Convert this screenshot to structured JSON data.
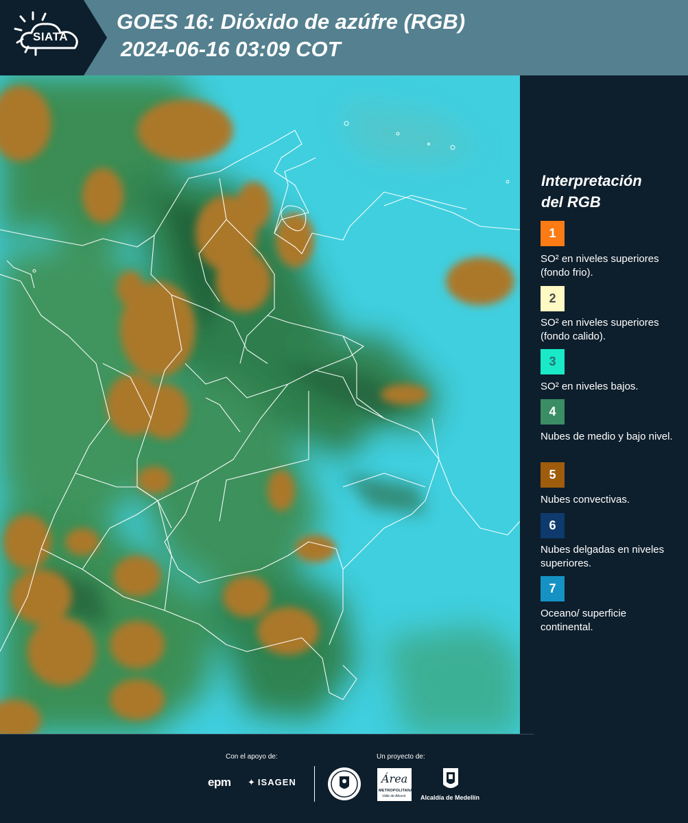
{
  "header": {
    "logo_text": "SIATA",
    "title_line1": "GOES 16: Dióxido de azúfre (RGB)",
    "title_line2": "2024-06-16 03:09 COT"
  },
  "legend": {
    "title_line1": "Interpretación",
    "title_line2": "del RGB",
    "items": [
      {
        "number": "1",
        "color": "#fb7b14",
        "text_color": "#ffffff",
        "description": "SO² en niveles superiores (fondo frio)."
      },
      {
        "number": "2",
        "color": "#fff9c4",
        "text_color": "#4a4a4a",
        "description": "SO² en niveles superiores (fondo calido)."
      },
      {
        "number": "3",
        "color": "#19e9c6",
        "text_color": "#2b6d72",
        "description": "SO² en niveles bajos."
      },
      {
        "number": "4",
        "color": "#3a8d64",
        "text_color": "#ffffff",
        "description": "Nubes de medio y bajo nivel."
      },
      {
        "number": "5",
        "color": "#9f5c0c",
        "text_color": "#ffffff",
        "description": "Nubes convectivas."
      },
      {
        "number": "6",
        "color": "#0e3a6d",
        "text_color": "#ffffff",
        "description": "Nubes delgadas en niveles superiores."
      },
      {
        "number": "7",
        "color": "#1592c3",
        "text_color": "#ffffff",
        "description": "Oceano/ superficie continental."
      }
    ]
  },
  "footer": {
    "support_label": "Con el apoyo de:",
    "project_label": "Un proyecto de:",
    "epm_logo": "epm",
    "isagen_logo": "ISAGEN",
    "area_logo": "Área",
    "area_sub1": "METROPOLITANA",
    "area_sub2": "Valle de Aburrá",
    "alcaldia_label": "Alcaldía de Medellín"
  },
  "colors": {
    "header_bg": "#54808f",
    "logo_bg": "#0d1e2c",
    "page_bg": "#0d1e2c",
    "ocean": "#3ccfdf",
    "land_green": "#3f8f56",
    "convective": "#a8772a"
  }
}
